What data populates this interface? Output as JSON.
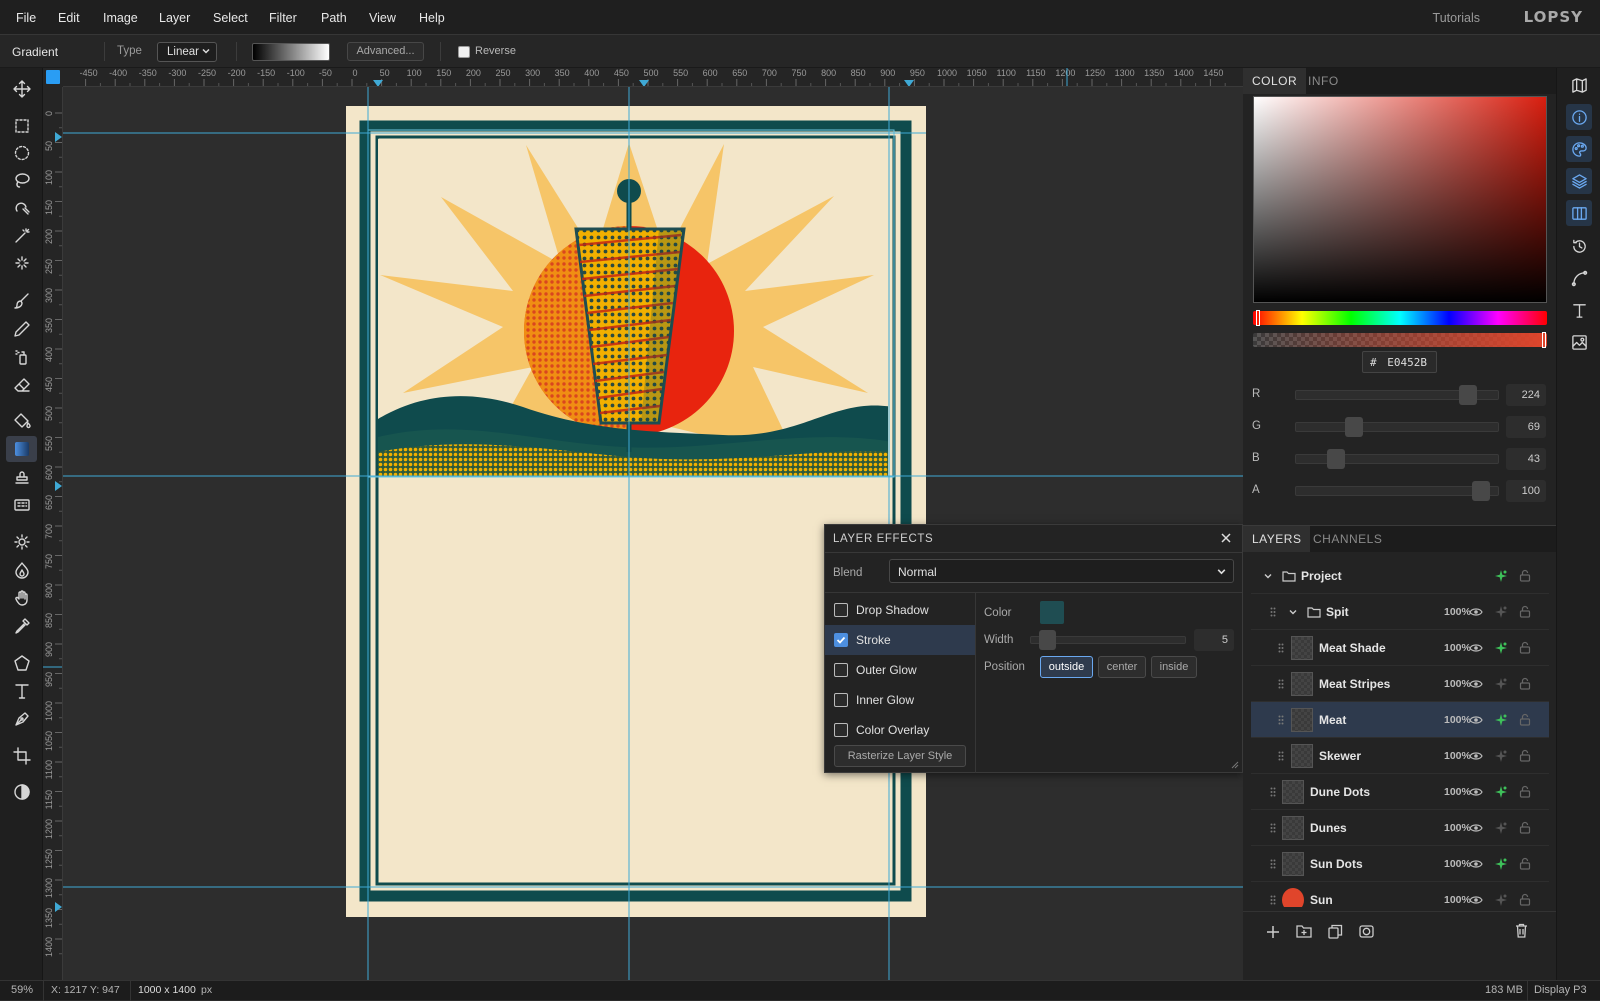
{
  "menubar": {
    "items": [
      "File",
      "Edit",
      "Image",
      "Layer",
      "Select",
      "Filter",
      "Path",
      "View",
      "Help"
    ],
    "tutorials": "Tutorials",
    "logo": "LOPSY"
  },
  "options": {
    "tool_name": "Gradient",
    "type_label": "Type",
    "type_value": "Linear",
    "advanced_label": "Advanced...",
    "reverse_label": "Reverse"
  },
  "toolbar": {
    "tools": [
      "move-tool-icon",
      "rect-select-icon",
      "ellipse-select-icon",
      "lasso-icon",
      "magnetic-lasso-icon",
      "magic-wand-icon",
      "quick-select-icon",
      "brush-icon",
      "pencil-icon",
      "spray-icon",
      "eraser-icon",
      "paint-bucket-icon",
      "gradient-icon",
      "clone-stamp-icon",
      "pattern-icon",
      "dodge-icon",
      "burn-icon",
      "hand-icon",
      "eyedropper-icon",
      "polygon-icon",
      "text-icon",
      "pen-icon",
      "crop-icon",
      "contrast-icon"
    ],
    "active": "gradient-icon"
  },
  "ruler": {
    "top_labels": [
      "-450",
      "-400",
      "-350",
      "-300",
      "-250",
      "-200",
      "-150",
      "-100",
      "-50",
      "0",
      "50",
      "100",
      "150",
      "200",
      "250",
      "300",
      "350",
      "400",
      "450",
      "500",
      "550",
      "600",
      "650",
      "700",
      "750",
      "800",
      "850",
      "900",
      "950",
      "1000",
      "1050",
      "1100",
      "1150",
      "1200",
      "1250",
      "1300",
      "1350",
      "1400",
      "1450"
    ],
    "left_labels": [
      "0",
      "50",
      "100",
      "150",
      "200",
      "250",
      "300",
      "350",
      "400",
      "450",
      "500",
      "550",
      "600",
      "650",
      "700",
      "750",
      "800",
      "850",
      "900",
      "950",
      "1000",
      "1050",
      "1100",
      "1150",
      "1200",
      "1250",
      "1300",
      "1350",
      "1400"
    ]
  },
  "color_panel": {
    "tabs": [
      "COLOR",
      "INFO"
    ],
    "hex_prefix": "#",
    "hex": "E0452B",
    "channels": [
      {
        "label": "R",
        "value": "224"
      },
      {
        "label": "G",
        "value": "69"
      },
      {
        "label": "B",
        "value": "43"
      },
      {
        "label": "A",
        "value": "100"
      }
    ],
    "channel_fractions": [
      0.88,
      0.27,
      0.17,
      0.95
    ]
  },
  "layer_effects": {
    "title": "LAYER EFFECTS",
    "blend_label": "Blend",
    "blend_value": "Normal",
    "effects": [
      {
        "label": "Drop Shadow",
        "checked": false
      },
      {
        "label": "Stroke",
        "checked": true
      },
      {
        "label": "Outer Glow",
        "checked": false
      },
      {
        "label": "Inner Glow",
        "checked": false
      },
      {
        "label": "Color Overlay",
        "checked": false
      }
    ],
    "rasterize_label": "Rasterize Layer Style",
    "color_label": "Color",
    "stroke_color": "#1f4d52",
    "width_label": "Width",
    "width_value": "5",
    "position_label": "Position",
    "positions": [
      "outside",
      "center",
      "inside"
    ],
    "position_selected": "outside"
  },
  "layers_panel": {
    "tabs": [
      "LAYERS",
      "CHANNELS"
    ],
    "layers": [
      {
        "name": "Project",
        "opacity": "",
        "type": "group"
      },
      {
        "name": "Spit",
        "opacity": "100%",
        "type": "group"
      },
      {
        "name": "Meat Shade",
        "opacity": "100%",
        "type": "layer"
      },
      {
        "name": "Meat Stripes",
        "opacity": "100%",
        "type": "layer"
      },
      {
        "name": "Meat",
        "opacity": "100%",
        "type": "layer",
        "selected": true
      },
      {
        "name": "Skewer",
        "opacity": "100%",
        "type": "layer"
      },
      {
        "name": "Dune Dots",
        "opacity": "100%",
        "type": "layer"
      },
      {
        "name": "Dunes",
        "opacity": "100%",
        "type": "layer"
      },
      {
        "name": "Sun Dots",
        "opacity": "100%",
        "type": "layer"
      },
      {
        "name": "Sun",
        "opacity": "100%",
        "type": "layer"
      }
    ]
  },
  "status": {
    "zoom": "59%",
    "coords": "X: 1217  Y: 947",
    "doc_size_value": "1000 x 1400",
    "doc_size_unit": "px",
    "memory": "183 MB",
    "color_profile": "Display P3"
  },
  "colors": {
    "accent": "#4d8fe0",
    "paper": "#f3e6c9",
    "teal": "#0f4b4d",
    "sun_red": "#e0452b",
    "sun_rays": "#f6c568",
    "meat_yellow": "#f2b000"
  }
}
